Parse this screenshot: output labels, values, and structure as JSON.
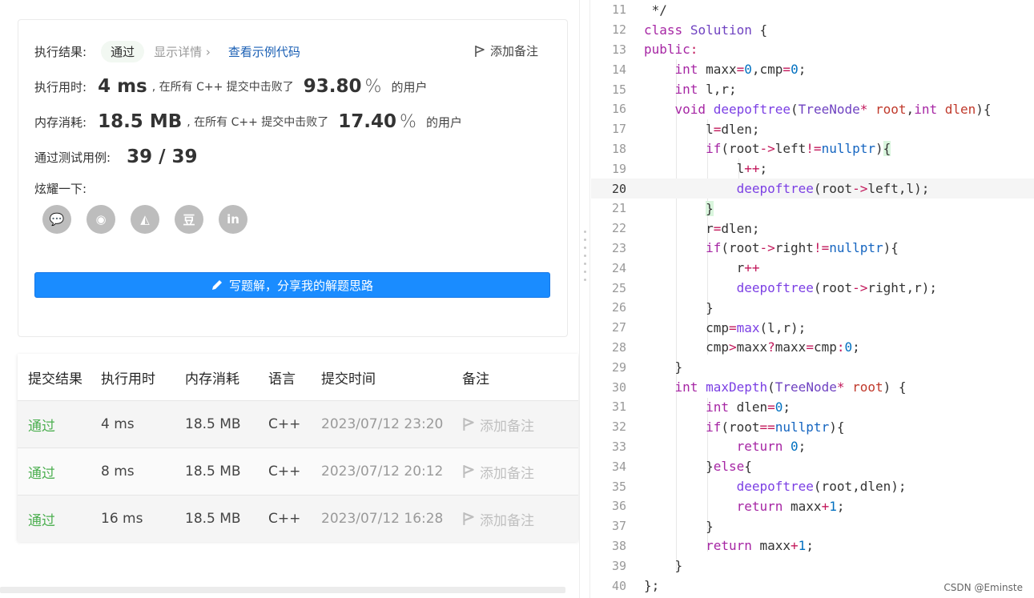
{
  "result": {
    "status_label": "执行结果:",
    "status": "通过",
    "detail": "显示详情",
    "sample": "查看示例代码",
    "add_note": "添加备注",
    "runtime_label": "执行用时:",
    "runtime_value": "4",
    "runtime_unit": "ms",
    "runtime_text": ", 在所有 C++ 提交中击败了",
    "runtime_pct": "93.80",
    "pct_sign": "%",
    "users": "的用户",
    "memory_label": "内存消耗:",
    "memory_value": "18.5",
    "memory_unit": "MB",
    "memory_text": ", 在所有 C++ 提交中击败了",
    "memory_pct": "17.40",
    "tests_label": "通过测试用例:",
    "tests_value": "39 / 39",
    "share_label": "炫耀一下:",
    "share_icons": [
      "wechat-icon",
      "weibo-icon",
      "qq-icon",
      "douban-icon",
      "linkedin-icon"
    ],
    "share_glyphs": [
      "💬",
      "◉",
      "◭",
      "豆",
      "in"
    ],
    "write_button": "写题解，分享我的解题思路"
  },
  "submissions": {
    "headers": [
      "提交结果",
      "执行用时",
      "内存消耗",
      "语言",
      "提交时间",
      "备注"
    ],
    "rows": [
      {
        "result": "通过",
        "time": "4 ms",
        "memory": "18.5 MB",
        "lang": "C++",
        "submitted": "2023/07/12 23:20",
        "note": "添加备注"
      },
      {
        "result": "通过",
        "time": "8 ms",
        "memory": "18.5 MB",
        "lang": "C++",
        "submitted": "2023/07/12 20:12",
        "note": "添加备注"
      },
      {
        "result": "通过",
        "time": "16 ms",
        "memory": "18.5 MB",
        "lang": "C++",
        "submitted": "2023/07/12 16:28",
        "note": "添加备注"
      }
    ]
  },
  "editor": {
    "current_line": 20,
    "lines": [
      {
        "n": "11",
        "html": " */"
      },
      {
        "n": "12",
        "html": "<span class=\"kw\">class</span> <span class=\"cls\">Solution</span> {"
      },
      {
        "n": "13",
        "html": "<span class=\"kw\">public</span><span class=\"op\">:</span>"
      },
      {
        "n": "14",
        "html": "    <span class=\"kw\">int</span> maxx<span class=\"op\">=</span><span class=\"nm\">0</span>,cmp<span class=\"op\">=</span><span class=\"nm\">0</span>;"
      },
      {
        "n": "15",
        "html": "    <span class=\"kw\">int</span> l,r;"
      },
      {
        "n": "16",
        "html": "    <span class=\"kw\">void</span> <span class=\"fn\">deepoftree</span>(<span class=\"cls\">TreeNode</span><span class=\"op\">*</span> <span class=\"par\">root</span>,<span class=\"kw\">int</span> <span class=\"par\">dlen</span>){"
      },
      {
        "n": "17",
        "html": "        l<span class=\"op\">=</span>dlen;"
      },
      {
        "n": "18",
        "html": "        <span class=\"kw\">if</span>(root<span class=\"op\">-&gt;</span>left<span class=\"op\">!=</span><span class=\"nul\">nullptr</span>)<span class=\"gbr\">{</span>"
      },
      {
        "n": "19",
        "html": "            l<span class=\"op\">++</span>;"
      },
      {
        "n": "20",
        "html": "            <span class=\"fn\">deepoftree</span>(root<span class=\"op\">-&gt;</span>left,l);"
      },
      {
        "n": "21",
        "html": "        <span class=\"gbr\">}</span>"
      },
      {
        "n": "22",
        "html": "        r<span class=\"op\">=</span>dlen;"
      },
      {
        "n": "23",
        "html": "        <span class=\"kw\">if</span>(root<span class=\"op\">-&gt;</span>right<span class=\"op\">!=</span><span class=\"nul\">nullptr</span>){"
      },
      {
        "n": "24",
        "html": "            r<span class=\"op\">++</span>"
      },
      {
        "n": "25",
        "html": "            <span class=\"fn\">deepoftree</span>(root<span class=\"op\">-&gt;</span>right,r);"
      },
      {
        "n": "26",
        "html": "        }"
      },
      {
        "n": "27",
        "html": "        cmp<span class=\"op\">=</span><span class=\"fn\">max</span>(l,r);"
      },
      {
        "n": "28",
        "html": "        cmp<span class=\"op\">&gt;</span>maxx<span class=\"op\">?</span>maxx<span class=\"op\">=</span>cmp<span class=\"op\">:</span><span class=\"nm\">0</span>;"
      },
      {
        "n": "29",
        "html": "    }"
      },
      {
        "n": "30",
        "html": "    <span class=\"kw\">int</span> <span class=\"fn\">maxDepth</span>(<span class=\"cls\">TreeNode</span><span class=\"op\">*</span> <span class=\"par\">root</span>) {"
      },
      {
        "n": "31",
        "html": "        <span class=\"kw\">int</span> dlen<span class=\"op\">=</span><span class=\"nm\">0</span>;"
      },
      {
        "n": "32",
        "html": "        <span class=\"kw\">if</span>(root<span class=\"op\">==</span><span class=\"nul\">nullptr</span>){"
      },
      {
        "n": "33",
        "html": "            <span class=\"kw\">return</span> <span class=\"nm\">0</span>;"
      },
      {
        "n": "34",
        "html": "        }<span class=\"kw\">else</span>{"
      },
      {
        "n": "35",
        "html": "            <span class=\"fn\">deepoftree</span>(root,dlen);"
      },
      {
        "n": "36",
        "html": "            <span class=\"kw\">return</span> maxx<span class=\"op\">+</span><span class=\"nm\">1</span>;"
      },
      {
        "n": "37",
        "html": "        }"
      },
      {
        "n": "38",
        "html": "        <span class=\"kw\">return</span> maxx<span class=\"op\">+</span><span class=\"nm\">1</span>;"
      },
      {
        "n": "39",
        "html": "    }"
      },
      {
        "n": "40",
        "html": "};"
      }
    ]
  },
  "watermark": "CSDN @Eminste"
}
